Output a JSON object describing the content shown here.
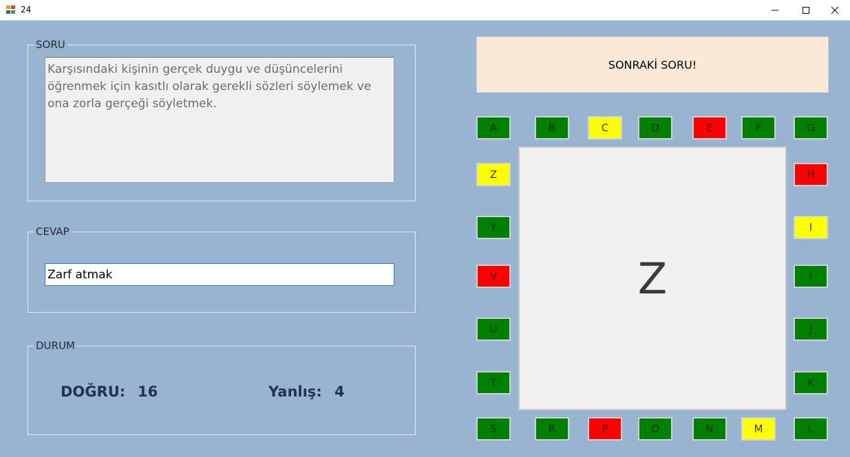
{
  "window": {
    "title": "24",
    "minimize_icon": "minimize-icon",
    "maximize_icon": "maximize-icon",
    "close_icon": "close-icon"
  },
  "question": {
    "label": "SORU",
    "text": "Karşısındaki kişinin gerçek duygu ve düşüncelerini öğrenmek için kasıtlı olarak gerekli sözleri söylemek ve ona zorla gerçeği söyletmek."
  },
  "answer": {
    "label": "CEVAP",
    "value": "Zarf atmak"
  },
  "status": {
    "label": "DURUM",
    "correct_label": "DOĞRU:",
    "correct_value": "16",
    "wrong_label": "Yanlış:",
    "wrong_value": "4"
  },
  "next_button": "SONRAKİ SORU!",
  "current_letter": "Z",
  "colors": {
    "green": "#008000",
    "yellow": "#ffff00",
    "red": "#ff0000",
    "background": "#99b4d1"
  },
  "letters": {
    "A": {
      "label": "A",
      "state": "green"
    },
    "B": {
      "label": "B",
      "state": "green"
    },
    "C": {
      "label": "C",
      "state": "yellow"
    },
    "D": {
      "label": "D",
      "state": "green"
    },
    "E": {
      "label": "E",
      "state": "red"
    },
    "F": {
      "label": "F",
      "state": "green"
    },
    "G": {
      "label": "G",
      "state": "green"
    },
    "H": {
      "label": "H",
      "state": "red"
    },
    "I": {
      "label": "I",
      "state": "yellow"
    },
    "Idot": {
      "label": "İ",
      "state": "green"
    },
    "J": {
      "label": "J",
      "state": "green"
    },
    "K": {
      "label": "K",
      "state": "green"
    },
    "L": {
      "label": "L",
      "state": "green"
    },
    "M": {
      "label": "M",
      "state": "yellow"
    },
    "N": {
      "label": "N",
      "state": "green"
    },
    "O": {
      "label": "O",
      "state": "green"
    },
    "P": {
      "label": "P",
      "state": "red"
    },
    "R": {
      "label": "R",
      "state": "green"
    },
    "S": {
      "label": "S",
      "state": "green"
    },
    "T": {
      "label": "T",
      "state": "green"
    },
    "U": {
      "label": "U",
      "state": "green"
    },
    "V": {
      "label": "V",
      "state": "red"
    },
    "Y": {
      "label": "Y",
      "state": "green"
    },
    "Z": {
      "label": "Z",
      "state": "yellow"
    }
  }
}
